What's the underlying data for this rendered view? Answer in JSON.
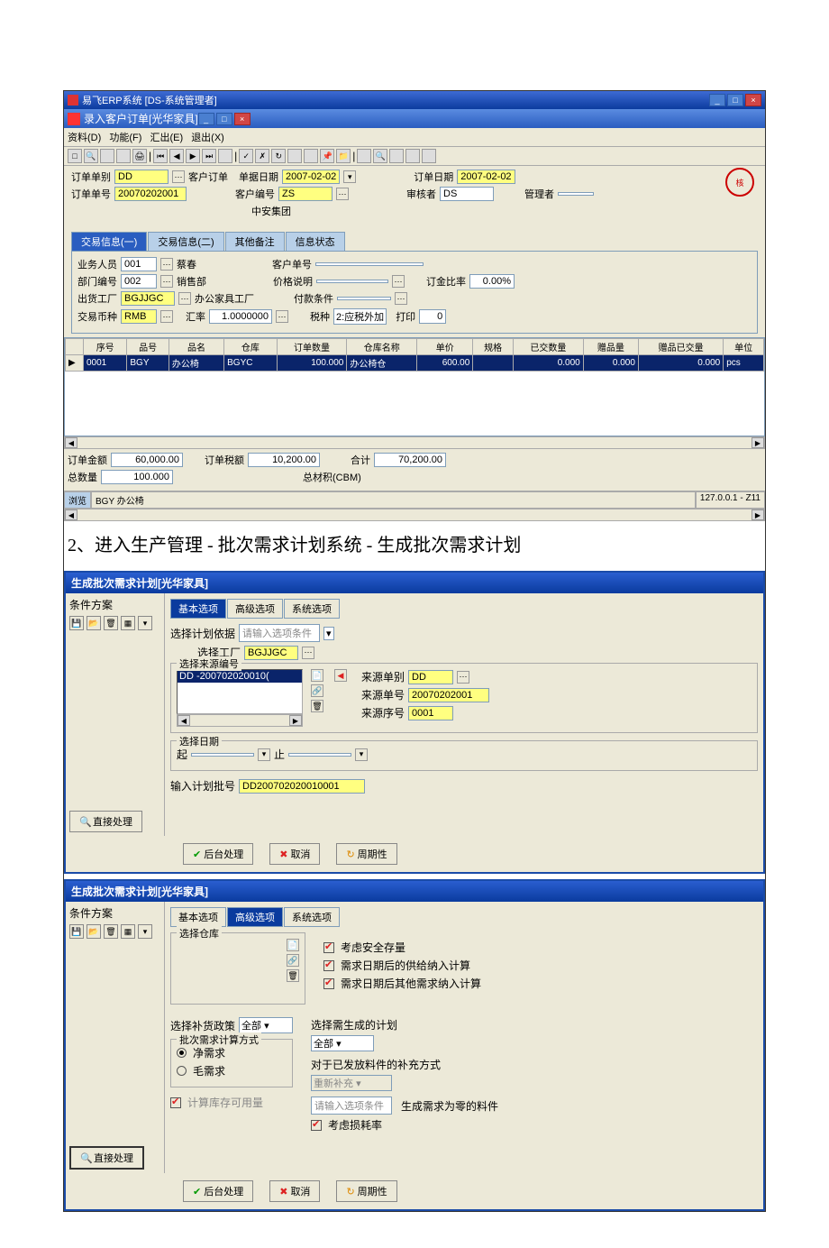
{
  "win1": {
    "app_title": "易飞ERP系统 [DS-系统管理者]",
    "doc_title": "录入客户订单[光华家具]",
    "menus": [
      "资料(D)",
      "功能(F)",
      "汇出(E)",
      "退出(X)"
    ],
    "form": {
      "order_type_label": "订单单别",
      "order_type": "DD",
      "order_type_name": "客户订单",
      "order_date_label": "单据日期",
      "order_date": "2007-02-02",
      "order_date2_label": "订单日期",
      "order_date2": "2007-02-02",
      "order_no_label": "订单单号",
      "order_no": "20070202001",
      "cust_no_label": "客户编号",
      "cust_no": "ZS",
      "audit_label": "审核者",
      "audit": "DS",
      "manager_label": "管理者",
      "cust_name": "中安集团"
    },
    "tabs": [
      "交易信息(一)",
      "交易信息(二)",
      "其他备注",
      "信息状态"
    ],
    "tx": {
      "sales_label": "业务人员",
      "sales_code": "001",
      "sales_name": "蔡春",
      "cust_order_no_label": "客户单号",
      "dept_label": "部门编号",
      "dept_code": "002",
      "dept_name": "销售部",
      "price_label": "价格说明",
      "discount_label": "订金比率",
      "discount": "0.00%",
      "ship_fac_label": "出货工厂",
      "ship_fac": "BGJJGC",
      "ship_fac_name": "办公家具工厂",
      "pay_cond_label": "付款条件",
      "currency_label": "交易币种",
      "currency": "RMB",
      "rate_label": "汇率",
      "rate": "1.0000000",
      "tax_label": "税种",
      "tax": "2:应税外加",
      "print_label": "打印",
      "print_val": "0"
    },
    "grid": {
      "cols": [
        "序号",
        "品号",
        "品名",
        "仓库",
        "订单数量",
        "仓库名称",
        "单价",
        "规格",
        "已交数量",
        "赠品量",
        "赠品已交量",
        "单位"
      ],
      "row": [
        "0001",
        "BGY",
        "办公椅",
        "BGYC",
        "100.000",
        "办公椅仓",
        "600.00",
        "",
        "0.000",
        "0.000",
        "0.000",
        "pcs"
      ]
    },
    "totals": {
      "amount_label": "订单金额",
      "amount": "60,000.00",
      "tax_amt_label": "订单税额",
      "tax_amt": "10,200.00",
      "sum_label": "合计",
      "sum": "70,200.00",
      "qty_label": "总数量",
      "qty": "100.000",
      "cbm_label": "总材积(CBM)"
    },
    "status": {
      "browse_label": "浏览",
      "browse_text": "BGY 办公椅",
      "version": "127.0.0.1 - Z11"
    }
  },
  "heading": "2、进入生产管理 - 批次需求计划系统 - 生成批次需求计划",
  "win2": {
    "title": "生成批次需求计划[光华家具]",
    "left_title": "条件方案",
    "tabs": [
      "基本选项",
      "高级选项",
      "系统选项"
    ],
    "basis_label": "选择计划依据",
    "basis_hint": "请输入选项条件",
    "factory_label": "选择工厂",
    "factory": "BGJJGC",
    "source_group": "选择来源编号",
    "source_item": "DD  -200702020010(",
    "src_type_label": "来源单别",
    "src_type": "DD",
    "src_no_label": "来源单号",
    "src_no": "20070202001",
    "src_seq_label": "来源序号",
    "src_seq": "0001",
    "date_group": "选择日期",
    "date_from": "起",
    "date_to": "止",
    "batch_label": "输入计划批号",
    "batch": "DD200702020010001",
    "btns": {
      "direct": "直接处理",
      "bg": "后台处理",
      "cancel": "取消",
      "period": "周期性"
    }
  },
  "win3": {
    "title": "生成批次需求计划[光华家具]",
    "left_title": "条件方案",
    "tabs": [
      "基本选项",
      "高级选项",
      "系统选项"
    ],
    "wh_group": "选择仓库",
    "chk_safety": "考虑安全存量",
    "chk_supply": "需求日期后的供给纳入计算",
    "chk_demand": "需求日期后其他需求纳入计算",
    "gen_label": "选择需生成的计划",
    "gen_val": "全部",
    "policy_label": "选择补货政策",
    "policy_val": "全部",
    "calc_group": "批次需求计算方式",
    "radio_net": "净需求",
    "radio_gross": "毛需求",
    "chk_stock": "计算库存可用量",
    "issued_label": "对于已发放料件的补充方式",
    "issued_val": "重新补充",
    "hint": "请输入选项条件",
    "zero_label": "生成需求为零的料件",
    "chk_loss": "考虑损耗率",
    "btns": {
      "direct": "直接处理",
      "bg": "后台处理",
      "cancel": "取消",
      "period": "周期性"
    }
  }
}
